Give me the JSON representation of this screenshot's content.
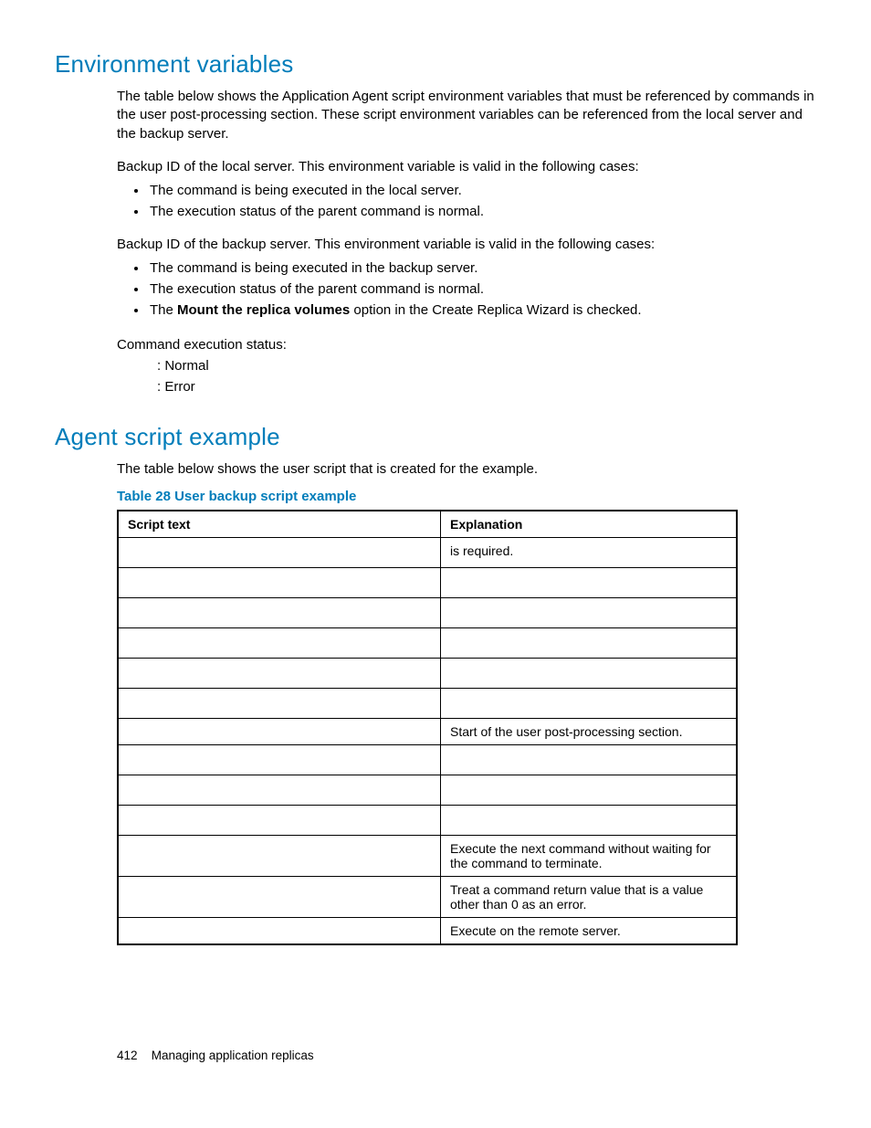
{
  "section1": {
    "title": "Environment variables",
    "intro": "The table below shows the Application Agent script environment variables that must be referenced by commands in the user post-processing section. These script environment variables can be referenced from the local server and the backup server.",
    "local_lead": "Backup ID of the local server. This environment variable is valid in the following cases:",
    "local_bullets": [
      "The command is being executed in the local server.",
      "The execution status of the parent command is normal."
    ],
    "backup_lead": "Backup ID of the backup server. This environment variable is valid in the following cases:",
    "backup_bullets_pre": [
      "The command is being executed in the backup server.",
      "The execution status of the parent command is normal."
    ],
    "backup_bullet3_prefix": "The ",
    "backup_bullet3_bold": "Mount the replica volumes",
    "backup_bullet3_suffix": " option in the Create Replica Wizard is checked.",
    "status_label": "Command execution status:",
    "status_normal": ": Normal",
    "status_error": ": Error"
  },
  "section2": {
    "title": "Agent script example",
    "intro": "The table below shows the user script that is created for the example.",
    "table_caption": "Table 28 User backup script example",
    "headers": {
      "c1": "Script text",
      "c2": "Explanation"
    },
    "rows": [
      {
        "c1": "",
        "c2": " is required."
      },
      {
        "c1": "",
        "c2": ""
      },
      {
        "c1": "",
        "c2": ""
      },
      {
        "c1": "",
        "c2": ""
      },
      {
        "c1": "",
        "c2": ""
      },
      {
        "c1": "",
        "c2": ""
      },
      {
        "c1": "",
        "c2": "Start of the user post-processing section."
      },
      {
        "c1": "",
        "c2": ""
      },
      {
        "c1": "",
        "c2": ""
      },
      {
        "c1": "",
        "c2": ""
      },
      {
        "c1": "",
        "c2": "Execute the next command without waiting for the command to terminate."
      },
      {
        "c1": "",
        "c2": "Treat a command return value that is a value other than 0 as an error."
      },
      {
        "c1": "",
        "c2": "Execute on the remote server."
      }
    ]
  },
  "footer": {
    "page_number": "412",
    "chapter": "Managing application replicas"
  }
}
